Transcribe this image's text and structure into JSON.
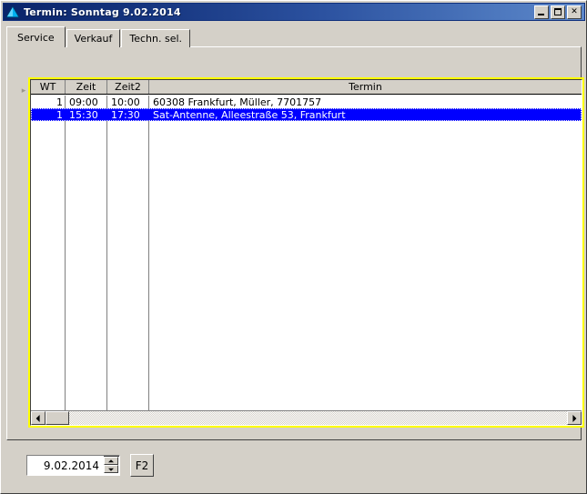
{
  "window": {
    "title": "Termin: Sonntag  9.02.2014",
    "icon": "blue-triangle-icon",
    "minimize_label": "",
    "maximize_label": "",
    "close_label": "✕"
  },
  "tabs": [
    {
      "label": "Service",
      "active": true
    },
    {
      "label": "Verkauf",
      "active": false
    },
    {
      "label": "Techn. sel.",
      "active": false
    }
  ],
  "grid": {
    "row_marker": "▸",
    "columns": [
      "WT",
      "Zeit",
      "Zeit2",
      "Termin"
    ],
    "rows": [
      {
        "wt": "1",
        "zeit": "09:00",
        "zeit2": "10:00",
        "termin": "60308 Frankfurt, Müller, 7701757",
        "selected": false
      },
      {
        "wt": "1",
        "zeit": "15:30",
        "zeit2": "17:30",
        "termin": "Sat-Antenne, Alleestraße 53, Frankfurt",
        "selected": true
      }
    ],
    "highlight_color": "#ffff00",
    "selection_color": "#0000ff"
  },
  "scrollbar": {
    "left_arrow": "◀",
    "right_arrow": "▶"
  },
  "bottom": {
    "date_value": "9.02.2014",
    "date_placeholder": "",
    "spin_up": "▲",
    "spin_down": "▼",
    "f2_label": "F2"
  }
}
